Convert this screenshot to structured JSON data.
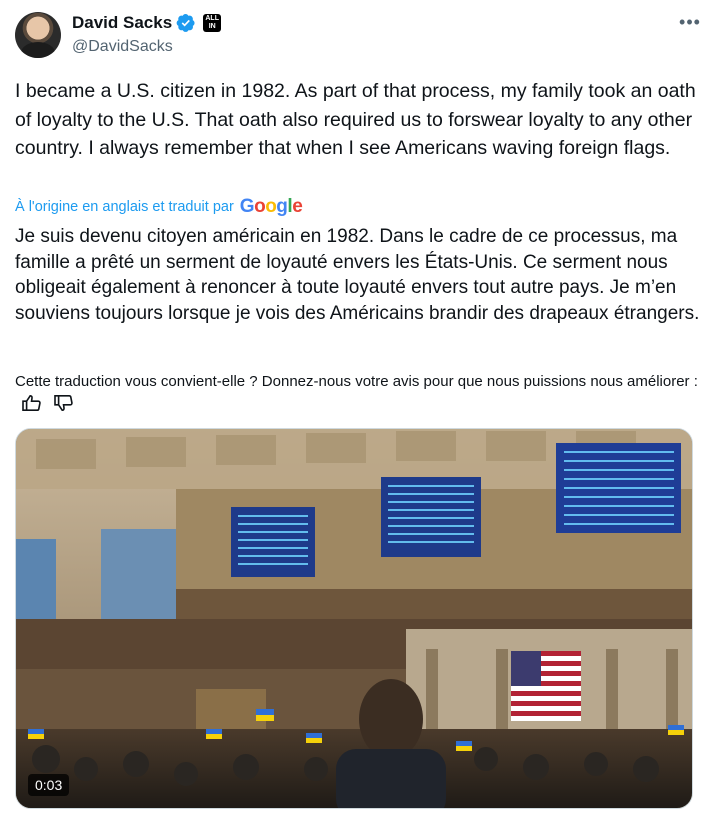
{
  "author": {
    "display_name": "David Sacks",
    "handle": "@DavidSacks",
    "affiliation_badge": "ALL IN",
    "verified_color": "#1d9bf0"
  },
  "more_icon": "more-dots-icon",
  "tweet": {
    "original_text": "I became a U.S. citizen in 1982. As part of that process, my family took an oath of loyalty to the U.S. That oath also required us to forswear loyalty to any other country. I always remember that when I see Americans waving foreign flags.",
    "translated_by_label": "À l'origine en anglais et traduit par",
    "translator_name": "Google",
    "translated_text": "Je suis devenu citoyen américain en 1982. Dans le cadre de ce processus, ma famille a prêté un serment de loyauté envers les États-Unis. Ce serment nous obligeait également à renoncer à toute loyauté envers tout autre pays. Je m’en souviens toujours lorsque je vois des Américains brandir des drapeaux étrangers."
  },
  "feedback": {
    "prompt": "Cette traduction vous convient-elle ? Donnez-nous votre avis pour que nous puissions nous améliorer :",
    "thumbs_up_icon": "thumbs-up-icon",
    "thumbs_down_icon": "thumbs-down-icon"
  },
  "video": {
    "timestamp": "0:03"
  },
  "colors": {
    "link": "#1d9bf0",
    "secondary_text": "#536471",
    "primary_text": "#0f1419"
  }
}
